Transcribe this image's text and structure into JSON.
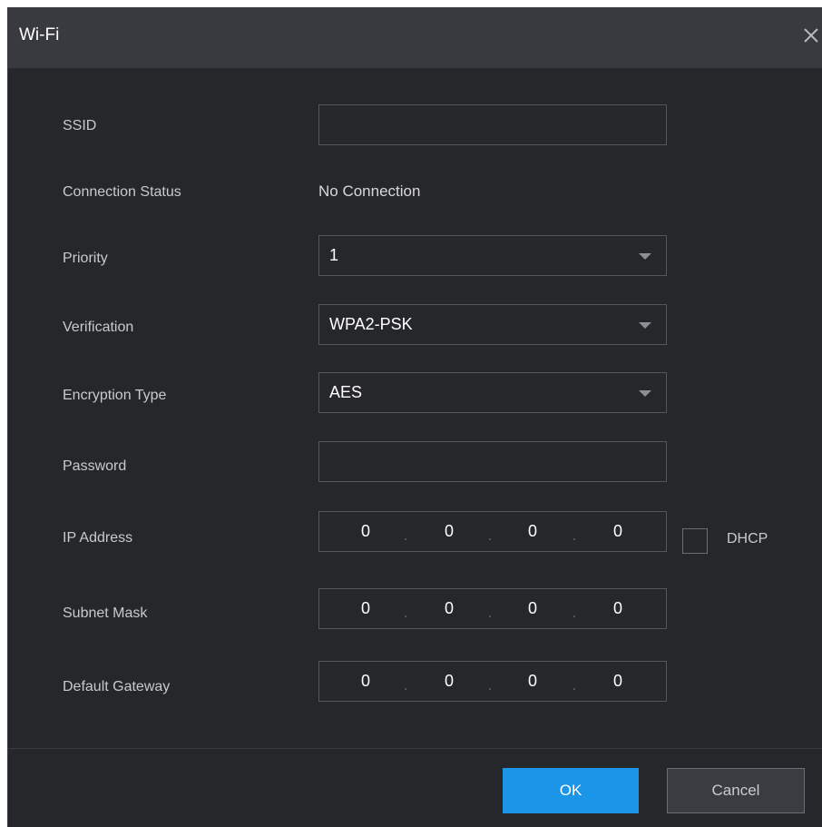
{
  "dialog": {
    "title": "Wi-Fi",
    "close_icon": "close-icon"
  },
  "fields": {
    "ssid": {
      "label": "SSID",
      "value": ""
    },
    "connection_status": {
      "label": "Connection Status",
      "value": "No Connection"
    },
    "priority": {
      "label": "Priority",
      "value": "1"
    },
    "verification": {
      "label": "Verification",
      "value": "WPA2-PSK"
    },
    "encryption_type": {
      "label": "Encryption Type",
      "value": "AES"
    },
    "password": {
      "label": "Password",
      "value": ""
    },
    "ip_address": {
      "label": "IP Address",
      "octets": [
        "0",
        "0",
        "0",
        "0"
      ],
      "dot": "."
    },
    "subnet_mask": {
      "label": "Subnet Mask",
      "octets": [
        "0",
        "0",
        "0",
        "0"
      ],
      "dot": "."
    },
    "default_gateway": {
      "label": "Default Gateway",
      "octets": [
        "0",
        "0",
        "0",
        "0"
      ],
      "dot": "."
    },
    "dhcp": {
      "label": "DHCP",
      "checked": false
    }
  },
  "buttons": {
    "ok": "OK",
    "cancel": "Cancel"
  },
  "colors": {
    "background": "#26272b",
    "titlebar": "#393a3f",
    "accent": "#1b95e7"
  }
}
